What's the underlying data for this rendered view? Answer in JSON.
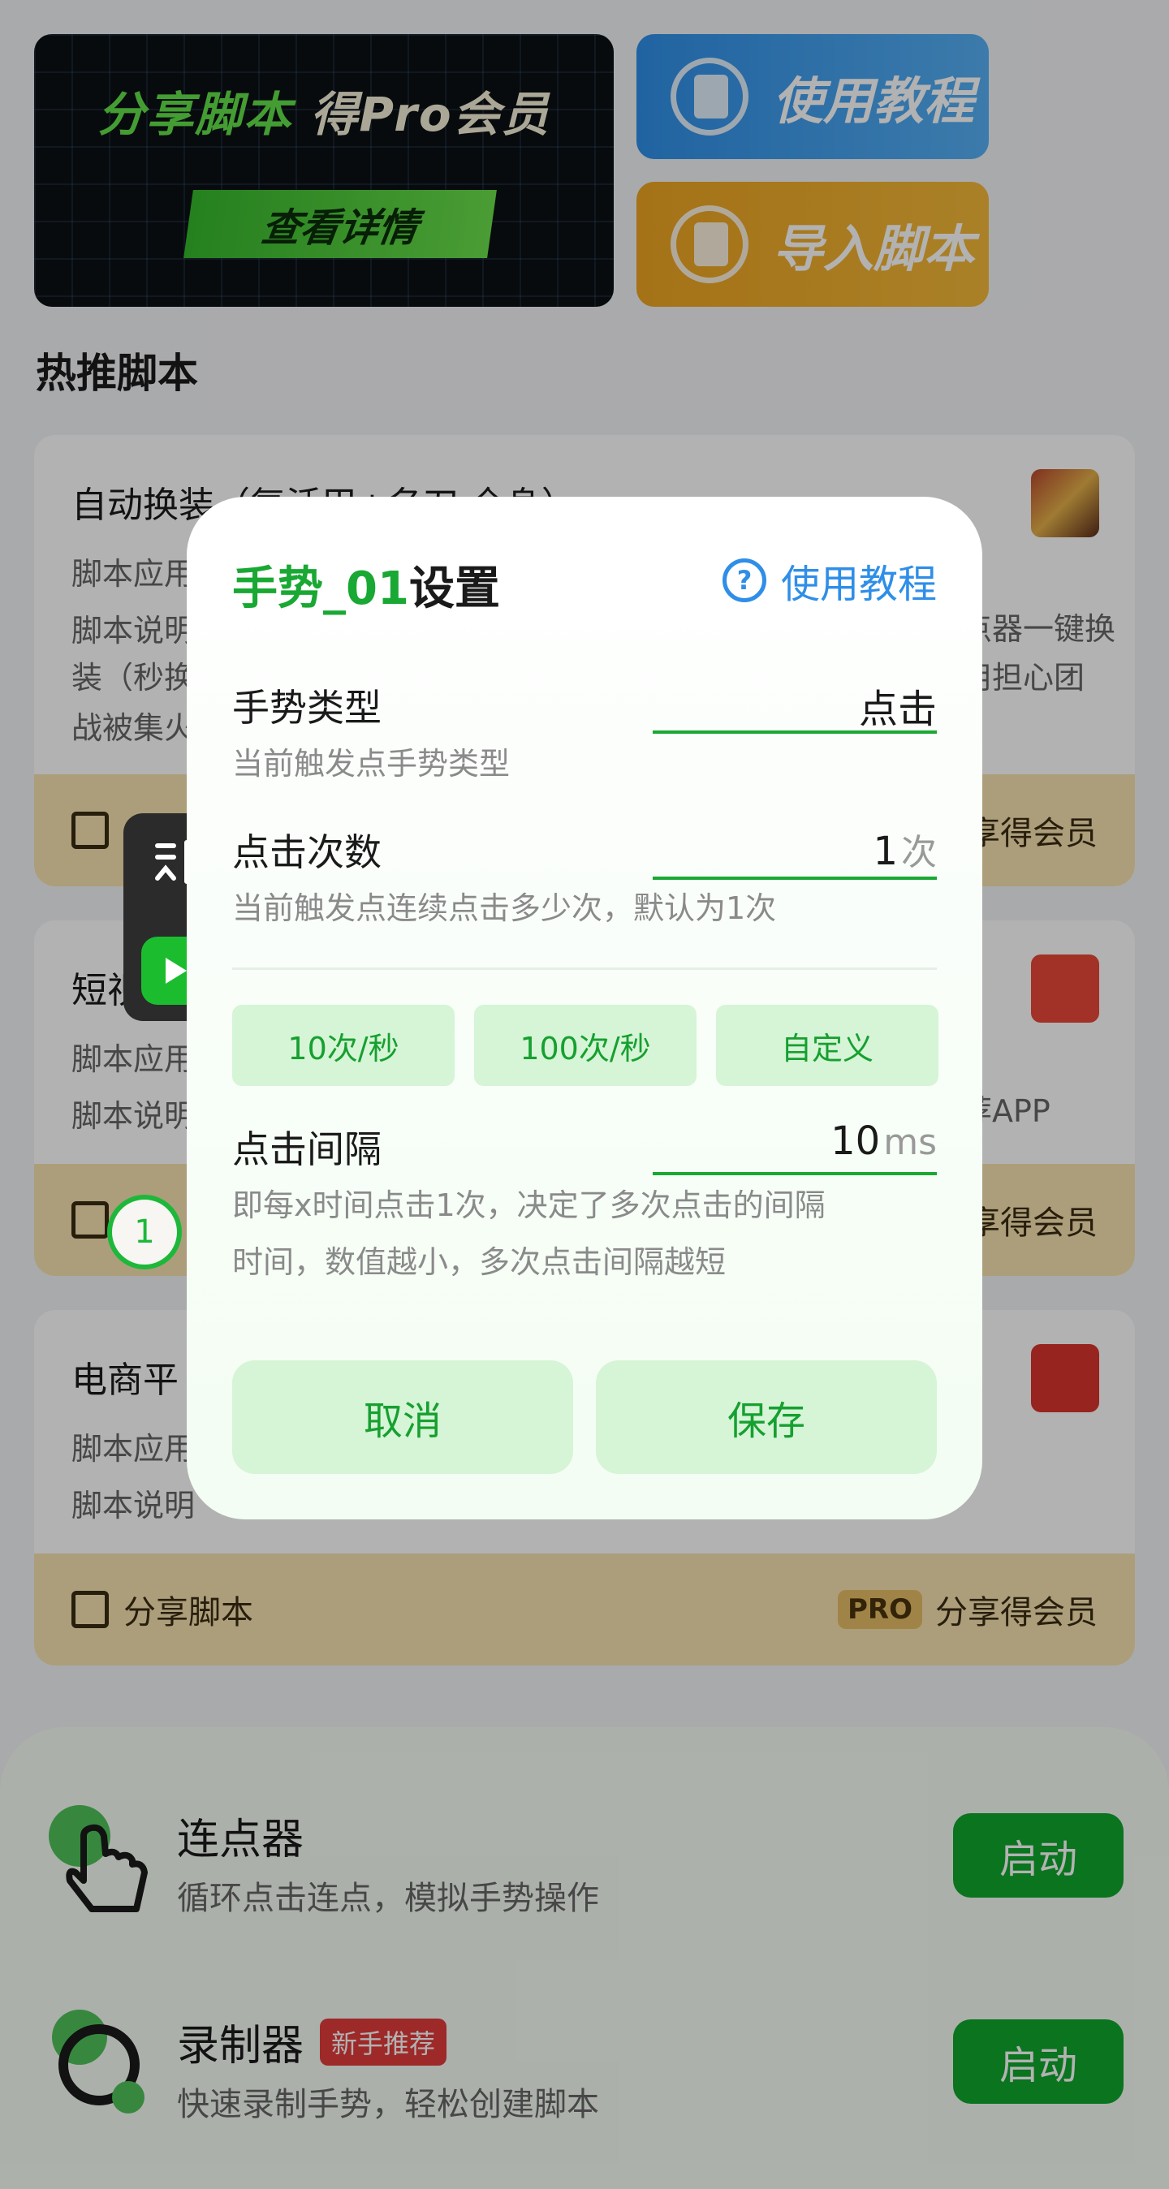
{
  "banner": {
    "title_green": "分享脚本",
    "title_white": "得Pro会员",
    "button": "查看详情"
  },
  "quick_buttons": {
    "tutorial": "使用教程",
    "import": "导入脚本"
  },
  "section_title": "热推脚本",
  "cards": [
    {
      "title": "自动换装（复活甲+名刀 全身）",
      "line1": "脚本应用",
      "line2": "脚本说明",
      "line3": "装（秒换",
      "line4": "战被集火",
      "right1": "点器一键换",
      "right2": "用担心团"
    },
    {
      "title": "短视",
      "line1": "脚本应用",
      "line2": "脚本说明",
      "right1": "荐APP"
    },
    {
      "title": "电商平",
      "line1": "脚本应用",
      "line2": "脚本说明"
    }
  ],
  "card_footer": {
    "share": "分享脚本",
    "share_partial": "分享",
    "pro": "PRO",
    "member": "分享得会员",
    "member_partial": "享得会员"
  },
  "tools": [
    {
      "name": "连点器",
      "desc": "循环点击连点，模拟手势操作",
      "button": "启动"
    },
    {
      "name": "录制器",
      "badge": "新手推荐",
      "desc": "快速录制手势，轻松创建脚本",
      "button": "启动"
    }
  ],
  "dialog": {
    "title_green": "手势_01",
    "title_black": "设置",
    "tutorial": "使用教程",
    "gesture_type": {
      "label": "手势类型",
      "value": "点击",
      "desc": "当前触发点手势类型"
    },
    "click_count": {
      "label": "点击次数",
      "value": "1",
      "unit": "次",
      "desc": "当前触发点连续点击多少次，默认为1次"
    },
    "presets": [
      "10次/秒",
      "100次/秒",
      "自定义"
    ],
    "interval": {
      "label": "点击间隔",
      "value": "10",
      "unit": "ms",
      "desc1": "即每x时间点击1次，决定了多次点击的间隔",
      "desc2": "时间，数值越小，多次点击间隔越短"
    },
    "cancel": "取消",
    "save": "保存"
  },
  "target_marker": "1",
  "colors": {
    "green": "#19a833",
    "blue": "#2f8ee8",
    "orange": "#eda421",
    "pro_gold": "#e5bd66"
  }
}
